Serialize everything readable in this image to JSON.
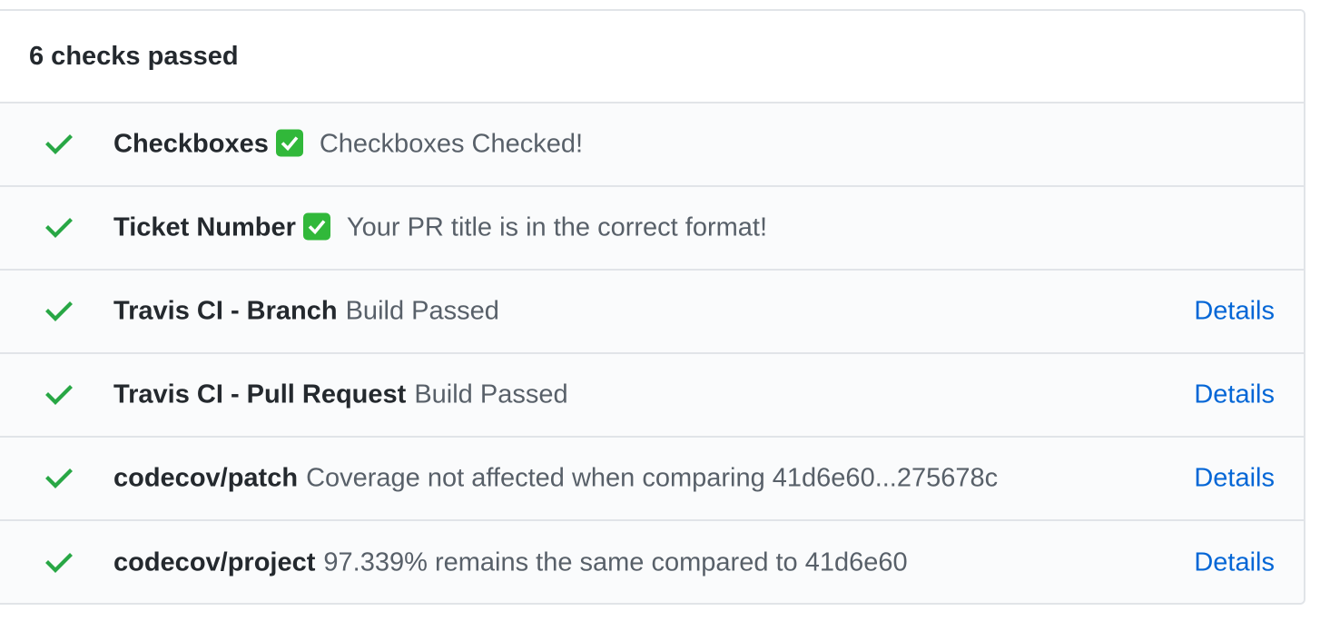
{
  "header": {
    "title": "6 checks passed"
  },
  "checks": [
    {
      "name": "Checkboxes",
      "emoji": "white-check-mark",
      "description": "Checkboxes Checked!",
      "details_label": ""
    },
    {
      "name": "Ticket Number",
      "emoji": "white-check-mark",
      "description": "Your PR title is in the correct format!",
      "details_label": ""
    },
    {
      "name": "Travis CI - Branch",
      "emoji": "",
      "description": "Build Passed",
      "details_label": "Details"
    },
    {
      "name": "Travis CI - Pull Request",
      "emoji": "",
      "description": "Build Passed",
      "details_label": "Details"
    },
    {
      "name": "codecov/patch",
      "emoji": "",
      "description": "Coverage not affected when comparing 41d6e60...275678c",
      "details_label": "Details"
    },
    {
      "name": "codecov/project",
      "emoji": "",
      "description": "97.339% remains the same compared to 41d6e60",
      "details_label": "Details"
    }
  ],
  "colors": {
    "success": "#28a745",
    "link": "#0366d6",
    "emoji_bg": "#31b83a"
  },
  "icons": {
    "status": "check-icon",
    "emoji": "white-check-mark-emoji-icon"
  }
}
